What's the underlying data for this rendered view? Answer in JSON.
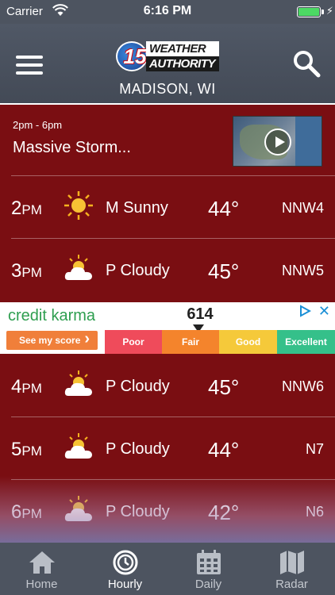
{
  "status_bar": {
    "carrier": "Carrier",
    "time": "6:16 PM"
  },
  "header": {
    "logo": {
      "number": "15",
      "line1": "WEATHER",
      "line2": "AUTHORITY"
    },
    "location": "MADISON, WI"
  },
  "story": {
    "time_range": "2pm - 6pm",
    "headline": "Massive Storm..."
  },
  "hourly": [
    {
      "hour": "2",
      "period": "PM",
      "icon": "sun-icon",
      "condition": "M Sunny",
      "temp": "44°",
      "wind": "NNW4"
    },
    {
      "hour": "3",
      "period": "PM",
      "icon": "partly-cloudy-icon",
      "condition": "P Cloudy",
      "temp": "45°",
      "wind": "NNW5"
    },
    {
      "hour": "4",
      "period": "PM",
      "icon": "partly-cloudy-icon",
      "condition": "P Cloudy",
      "temp": "45°",
      "wind": "NNW6"
    },
    {
      "hour": "5",
      "period": "PM",
      "icon": "partly-cloudy-icon",
      "condition": "P Cloudy",
      "temp": "44°",
      "wind": "N7"
    },
    {
      "hour": "6",
      "period": "PM",
      "icon": "partly-cloudy-icon",
      "condition": "P Cloudy",
      "temp": "42°",
      "wind": "N6"
    }
  ],
  "ad": {
    "brand": "credit karma",
    "cta": "See my score",
    "score": "614",
    "bands": [
      {
        "label": "Poor",
        "color": "#ef4b5b"
      },
      {
        "label": "Fair",
        "color": "#f4842c"
      },
      {
        "label": "Good",
        "color": "#f5c93a"
      },
      {
        "label": "Excellent",
        "color": "#35c08a"
      }
    ]
  },
  "tabs": [
    {
      "label": "Home",
      "icon": "home-icon"
    },
    {
      "label": "Hourly",
      "icon": "clock-icon",
      "active": true
    },
    {
      "label": "Daily",
      "icon": "calendar-icon"
    },
    {
      "label": "Radar",
      "icon": "map-icon"
    }
  ],
  "colors": {
    "background": "#7a0e12",
    "bar": "#4d5460",
    "accent": "#2e9e4f"
  }
}
